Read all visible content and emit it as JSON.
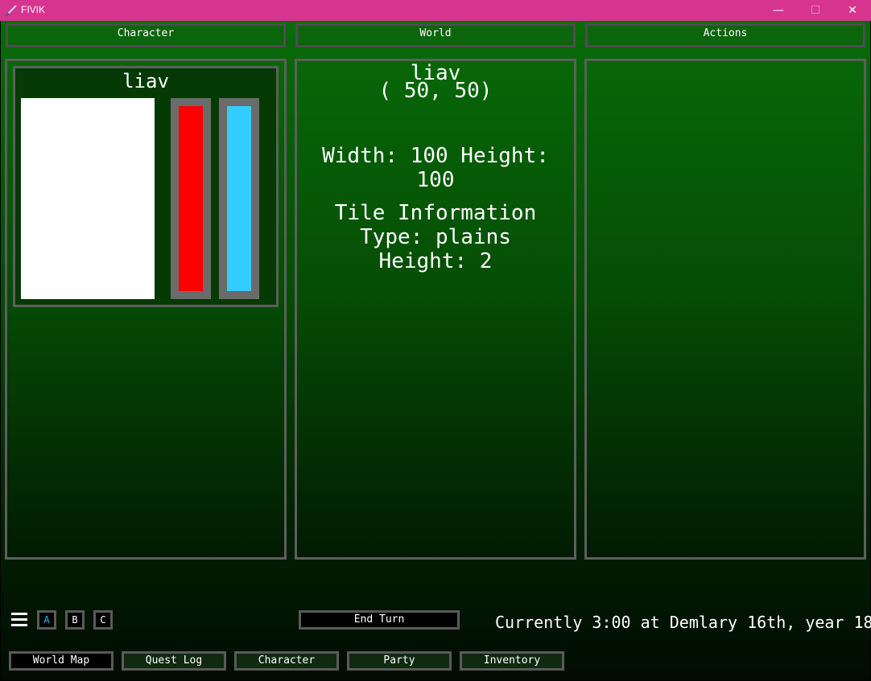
{
  "window": {
    "title": "FIVIK",
    "minimize_glyph": "—",
    "maximize_glyph": "☐",
    "close_glyph": "✕",
    "icon": "sword-icon"
  },
  "tabs": {
    "character": "Character",
    "world": "World",
    "actions": "Actions"
  },
  "character_panel": {
    "name": "liav",
    "health_color": "#ff0000",
    "mana_color": "#33ccff"
  },
  "world_panel": {
    "name": "liav",
    "coords": "( 50, 50)",
    "dimensions": "Width: 100 Height: 100",
    "tile_heading": "Tile Information",
    "tile_type": "Type: plains",
    "tile_height": "Height: 2"
  },
  "controls": {
    "menu_icon": "hamburger-menu-icon",
    "layout_buttons": [
      "A",
      "B",
      "C"
    ],
    "end_turn": "End Turn",
    "status": "Currently 3:00 at Demlary 16th, year 18"
  },
  "nav_buttons": [
    "World Map",
    "Quest Log",
    "Character",
    "Party",
    "Inventory"
  ],
  "colors": {
    "title_bar": "#d5358f",
    "panel_green": "#086b08",
    "border_gray": "#5e5e5e"
  }
}
